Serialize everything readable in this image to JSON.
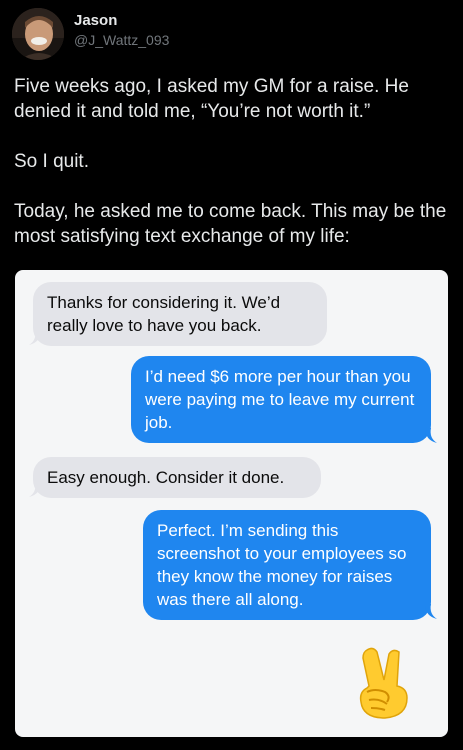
{
  "author": {
    "name": "Jason",
    "handle": "@J_Wattz_093",
    "avatar_icon": "user-avatar"
  },
  "tweet": {
    "paragraphs": [
      "Five weeks ago, I asked my GM for a raise. He denied it and told me, “You’re not worth it.”",
      "So I quit.",
      "Today, he asked me to come back. This may be the most satisfying text exchange of my life:"
    ]
  },
  "conversation": {
    "messages": [
      {
        "side": "received",
        "text": "Thanks for considering it. We’d really love to have you back."
      },
      {
        "side": "sent",
        "text": "I’d need $6 more per hour than you were paying me to leave my current job."
      },
      {
        "side": "received",
        "text": "Easy enough. Consider it done."
      },
      {
        "side": "sent",
        "text": "Perfect. I’m sending this screenshot to your employees so they know the money for raises was there all along."
      }
    ],
    "reaction_icon": "victory-hand-emoji"
  },
  "colors": {
    "background": "#000000",
    "sent_bubble": "#1f86ef",
    "received_bubble": "#e3e4e9",
    "screenshot_bg": "#f5f6f7"
  }
}
